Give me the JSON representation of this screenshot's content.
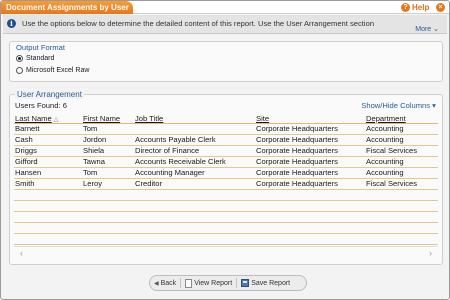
{
  "window": {
    "title": "Document Assignments by User",
    "help_label": "Help",
    "help_glyph": "?",
    "close_glyph": "×"
  },
  "info": {
    "glyph": "i",
    "text": "Use the options below to determine the detailed content of this report. Use the User Arrangement section",
    "more_label": "More ⌄"
  },
  "output_format": {
    "title": "Output Format",
    "options": [
      "Standard",
      "Microsoft Excel Raw"
    ],
    "selected": "Standard"
  },
  "user_arrangement": {
    "title": "User Arrangement",
    "users_found": "Users Found: 6",
    "show_hide_label": "Show/Hide Columns ▾",
    "columns": [
      "Last Name",
      "First Name",
      "Job Title",
      "Site",
      "Department"
    ],
    "rows": [
      [
        "Barnett",
        "Tom",
        "",
        "Corporate Headquarters",
        "Accounting"
      ],
      [
        "Cash",
        "Jordon",
        "Accounts Payable Clerk",
        "Corporate Headquarters",
        "Accounting"
      ],
      [
        "Driggs",
        "Shiela",
        "Director of Finance",
        "Corporate Headquarters",
        "Fiscal Services"
      ],
      [
        "Gifford",
        "Tawna",
        "Accounts Receivable Clerk",
        "Corporate Headquarters",
        "Accounting"
      ],
      [
        "Hansen",
        "Tom",
        "Accounting Manager",
        "Corporate Headquarters",
        "Accounting"
      ],
      [
        "Smith",
        "Leroy",
        "Creditor",
        "Corporate Headquarters",
        "Fiscal Services"
      ]
    ]
  },
  "footer": {
    "back_label": "Back",
    "view_label": "View Report",
    "save_label": "Save Report"
  },
  "colors": {
    "accent": "#e8761a",
    "link": "#2a5b9a",
    "row_line": "#e8c888"
  }
}
